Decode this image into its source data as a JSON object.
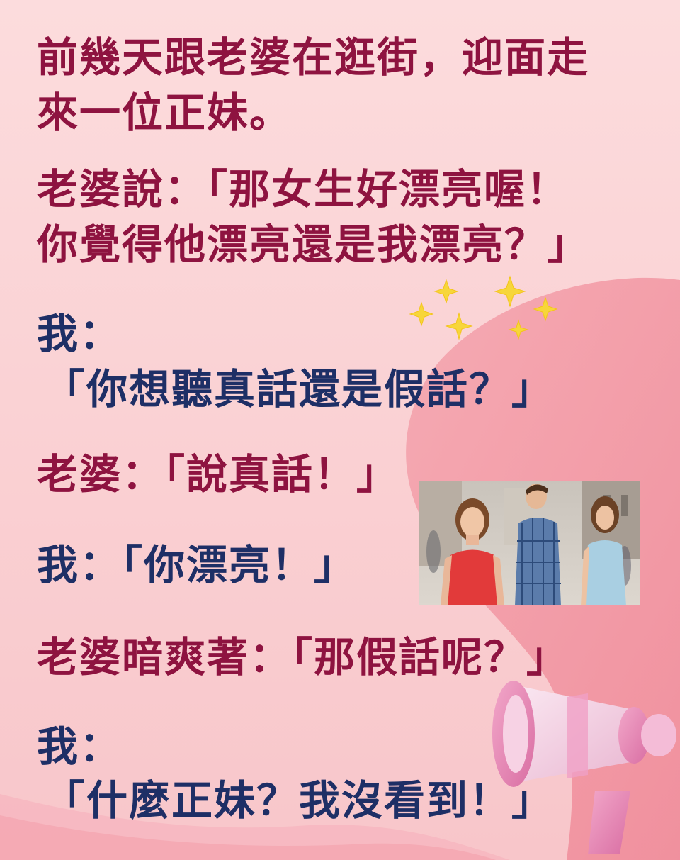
{
  "story": {
    "intro_line1": "前幾天跟老婆在逛街，迎面走",
    "intro_line2": "來一位正妹。",
    "wife_q_line1": "老婆說：「那女生好漂亮喔！",
    "wife_q_line2": "你覺得他漂亮還是我漂亮？」",
    "me_label_1": "我：",
    "me_reply_1": "「你想聽真話還是假話？」",
    "wife_reply_1": "老婆：「說真話！」",
    "me_reply_2": "我：「你漂亮！」",
    "wife_reply_2": "老婆暗爽著：「那假話呢？」",
    "me_label_2": "我：",
    "me_reply_3": "「什麼正妹？我沒看到！」"
  },
  "colors": {
    "background": "#fbd3d5",
    "blob": "#f1939f",
    "text_red": "#8e1340",
    "text_blue": "#1e2f66",
    "sparkle": "#f7d63a"
  },
  "icons": {
    "sparkles": "sparkle-icon",
    "megaphone": "megaphone-icon"
  },
  "image": {
    "kind": "distracted-boyfriend-meme-photo"
  }
}
